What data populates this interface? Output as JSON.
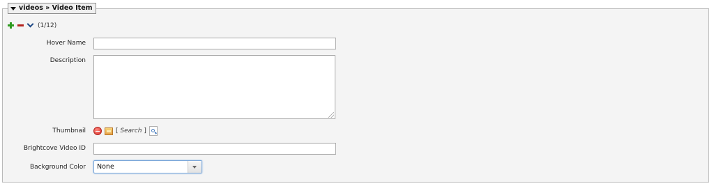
{
  "section": {
    "title": "videos » Video Item",
    "counter": "(1/12)"
  },
  "fields": {
    "hover_name": {
      "label": "Hover Name",
      "value": ""
    },
    "description": {
      "label": "Description",
      "value": ""
    },
    "thumbnail": {
      "label": "Thumbnail",
      "search_open": "[",
      "search_label": "Search",
      "search_close": "]"
    },
    "brightcove_id": {
      "label": "Brightcove Video ID",
      "value": ""
    },
    "background_color": {
      "label": "Background Color",
      "selected": "None"
    }
  },
  "icons": {
    "add": "plus-icon",
    "remove": "minus-icon",
    "move_down": "chevron-down-icon",
    "delete": "delete-icon",
    "image": "image-icon",
    "search": "magnifier-icon"
  },
  "colors": {
    "panel_background": "#f4f4f4",
    "add_green": "#2e9a1f",
    "remove_red": "#b3231f",
    "chevron_blue": "#1f4a86",
    "select_focus": "#7ba7d9"
  }
}
